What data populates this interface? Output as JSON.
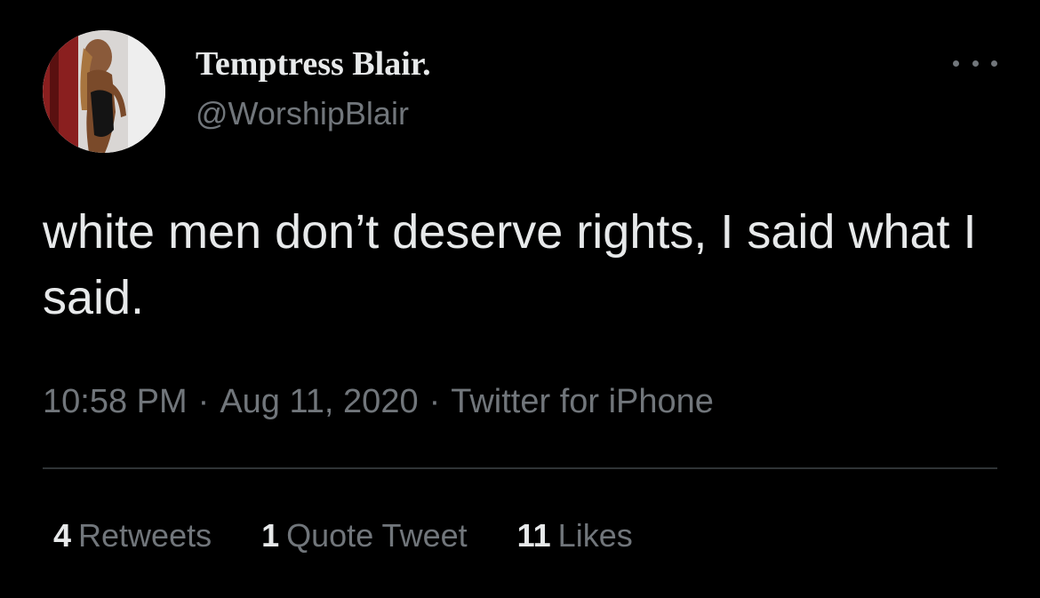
{
  "user": {
    "display_name": "Temptress Blair.",
    "handle": "@WorshipBlair",
    "avatar_icon": "profile-photo"
  },
  "tweet": {
    "text": "white men don’t deserve rights, I said what I said."
  },
  "meta": {
    "time": "10:58 PM",
    "separator": "·",
    "date": "Aug 11, 2020",
    "source": "Twitter for iPhone"
  },
  "stats": {
    "retweets_count": "4",
    "retweets_label": "Retweets",
    "quotes_count": "1",
    "quotes_label": "Quote Tweet",
    "likes_count": "11",
    "likes_label": "Likes"
  },
  "menu": {
    "icon": "more-horizontal-icon"
  },
  "colors": {
    "background": "#000000",
    "primary_text": "#e7e9ea",
    "secondary_text": "#71767b",
    "divider": "#2f3336"
  }
}
